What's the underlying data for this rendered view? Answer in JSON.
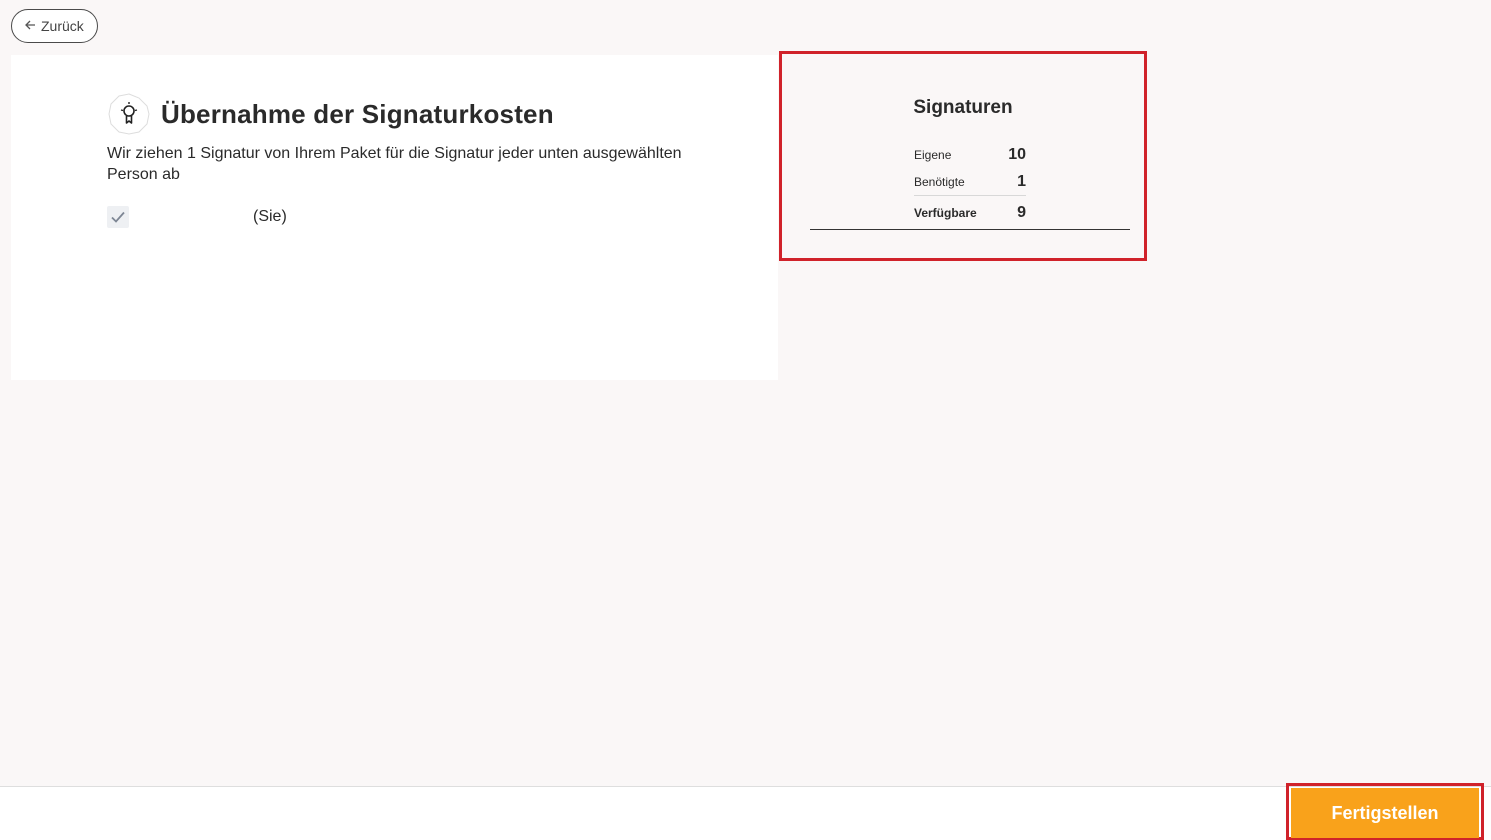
{
  "nav": {
    "back_label": "Zurück"
  },
  "main": {
    "title": "Übernahme der Signaturkosten",
    "description": "Wir ziehen 1 Signatur von Ihrem Paket für die Signatur jeder unten ausgewählten Person ab",
    "person": {
      "suffix": "(Sie)",
      "checked": true
    }
  },
  "signatures": {
    "title": "Signaturen",
    "rows": [
      {
        "label": "Eigene",
        "value": "10"
      },
      {
        "label": "Benötigte",
        "value": "1"
      }
    ],
    "total": {
      "label": "Verfügbare",
      "value": "9"
    }
  },
  "footer": {
    "finish_label": "Fertigstellen"
  },
  "colors": {
    "accent": "#f9a21b",
    "highlight": "#d0222a",
    "background": "#faf7f7"
  },
  "icons": {
    "back": "arrow-left-icon",
    "title": "lightbulb-badge-icon",
    "checkbox": "check-icon"
  }
}
